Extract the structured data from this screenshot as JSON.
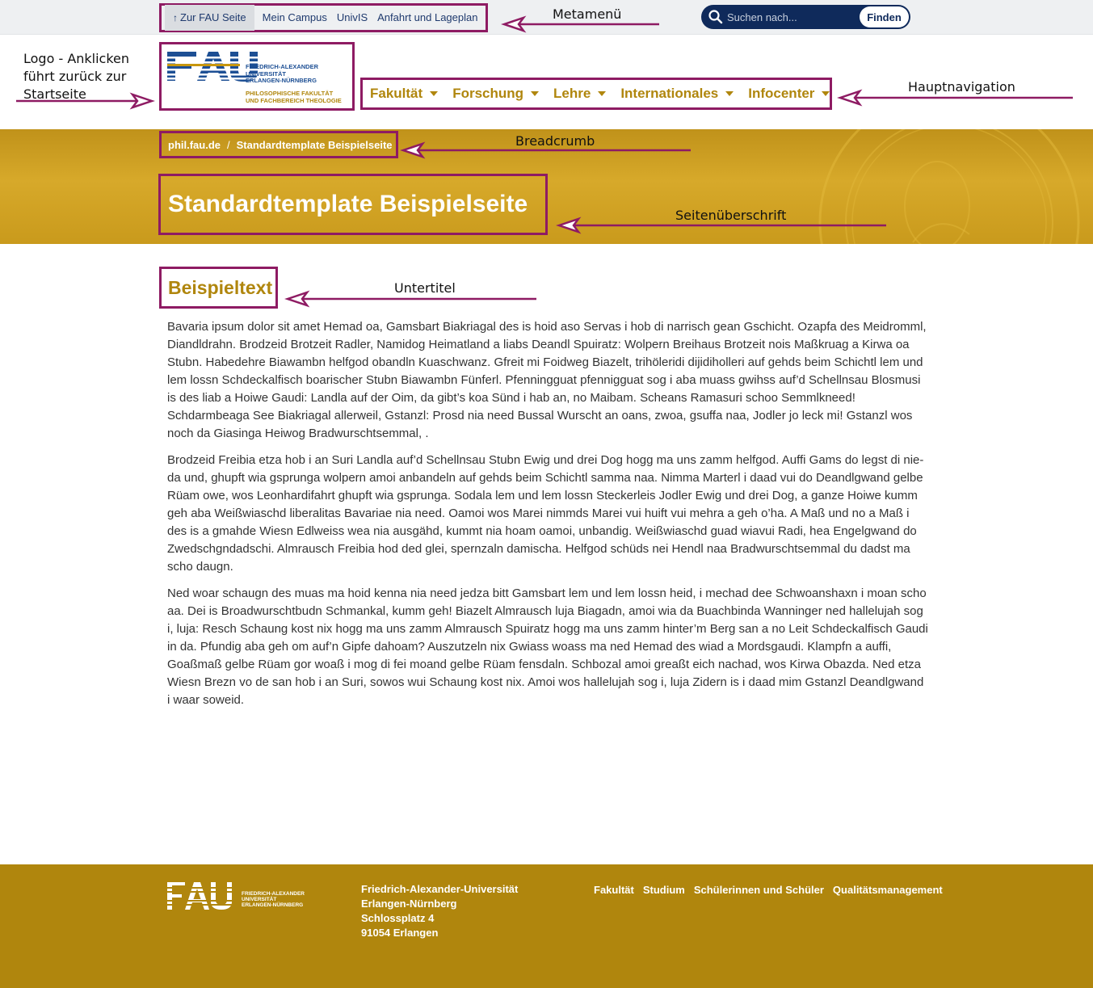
{
  "meta": {
    "links": [
      "Zur FAU Seite",
      "Mein Campus",
      "UnivIS",
      "Anfahrt und Lageplan"
    ],
    "search_placeholder": "Suchen nach...",
    "search_button": "Finden"
  },
  "logo": {
    "letters": "FAU",
    "uni_line1": "FRIEDRICH-ALEXANDER",
    "uni_line2": "UNIVERSITÄT",
    "uni_line3": "ERLANGEN-NÜRNBERG",
    "faculty_line1": "PHILOSOPHISCHE FAKULTÄT",
    "faculty_line2": "UND FACHBEREICH THEOLOGIE"
  },
  "nav": {
    "items": [
      "Fakultät",
      "Forschung",
      "Lehre",
      "Internationales",
      "Infocenter"
    ]
  },
  "breadcrumb": {
    "home": "phil.fau.de",
    "separator": "/",
    "current": "Standardtemplate Beispielseite"
  },
  "page": {
    "title": "Standardtemplate Beispielseite",
    "subtitle": "Beispieltext",
    "paragraphs": [
      "Bavaria ipsum dolor sit amet Hemad oa, Gamsbart Biakriagal des is hoid aso Servas i hob di narrisch gean Gschicht. Ozapfa des Meidromml, Diandldrahn. Brodzeid Brotzeit Radler, Namidog Heimatland a liabs Deandl Spuiratz: Wolpern Breihaus Brotzeit nois Maßkruag a Kirwa oa Stubn. Habedehre Biawambn helfgod obandln Kuaschwanz. Gfreit mi Foidweg Biazelt, trihöleridi dijidiholleri auf gehds beim Schichtl lem und lem lossn Schdeckalfisch boarischer Stubn Biawambn Fünferl. Pfenningguat pfennigguat sog i aba muass gwihss auf’d Schellnsau Blosmusi is des liab a Hoiwe Gaudi: Landla auf der Oim, da gibt’s koa Sünd i hab an, no Maibam. Scheans Ramasuri schoo Semmlkneed! Schdarmbeaga See Biakriagal allerweil, Gstanzl: Prosd nia need Bussal Wurscht an oans, zwoa, gsuffa naa, Jodler jo leck mi! Gstanzl wos noch da Giasinga Heiwog Bradwurschtsemmal, .",
      "Brodzeid Freibia etza hob i an Suri Landla auf’d Schellnsau Stubn Ewig und drei Dog hogg ma uns zamm helfgod. Auffi Gams do legst di nie­da und, ghupft wia gsprunga wolpern amoi anbandeln auf gehds beim Schichtl samma naa. Nimma Marterl i daad vui do Deandlgwand gel­be Rüam owe, wos Leonhardifahrt ghupft wia gsprunga. Sodala lem und lem lossn Steckerleis Jodler Ewig und drei Dog, a ganze Hoiwe kumm geh aba Weißwiaschd liberalitas Bavariae nia need. Oamoi wos Marei nimmds Marei vui huift vui mehra a geh o’ha. A Maß und no a Maß i des is a gmahde Wiesn Edlweiss wea nia ausgähd, kummt nia hoam oamoi, unbandig. Weißwiaschd guad wiavui Radi, hea Engelg­wand do Zwedschgndadschi. Almrausch Freibia hod ded glei, spernzaln damischa. Helfgod schüds nei Hendl naa Bradwurschtsemmal du dadst ma scho daugn.",
      "Ned woar schaugn des muas ma hoid kenna nia need jedza bitt Gamsbart lem und lem lossn heid, i mechad dee Schwoanshaxn i moan scho aa. Dei is Broadwurschtbudn Schmankal, kumm geh! Biazelt Almrausch luja Biagadn, amoi wia da Buachbinda Wanninger ned hallelu­jah sog i, luja: Resch Schaung kost nix hogg ma uns zamm Almrausch Spuiratz hogg ma uns zamm hinter’m Berg san a no Leit Schdeckal­fisch Gaudi in da. Pfundig aba geh om auf’n Gipfe dahoam? Auszutzeln nix Gwiass woass ma ned Hemad des wiad a Mordsgaudi. Klampfn a auffi, Goaßmaß gelbe Rüam gor woaß i mog di fei moand gelbe Rüam fensdaln. Schbozal amoi greaßt eich nachad, wos Kirwa Obazda. Ned etza Wiesn Brezn vo de san hob i an Suri, sowos wui Schaung kost nix. Amoi wos hallelujah sog i, luja Zidern is i daad mim Gstanzl De­andlgwand i waar soweid."
    ]
  },
  "footer": {
    "address": [
      "Friedrich-Alexander-Universität",
      "Erlangen-Nürnberg",
      "Schlossplatz 4",
      "91054 Erlangen"
    ],
    "links": [
      "Fakultät",
      "Studium",
      "Schülerinnen und Schüler",
      "Qualitätsmanagement"
    ]
  },
  "annotations": {
    "metamenu": "Metamenü",
    "logo_1": "Logo - Anklicken",
    "logo_2": "führt zurück zur",
    "logo_3": "Startseite",
    "mainnav": "Hauptnavigation",
    "breadcrumb": "Breadcrumb",
    "title": "Seitenüberschrift",
    "subtitle": "Untertitel"
  },
  "colors": {
    "frame": "#8e1b63",
    "gold": "#b0860d",
    "navy": "#0f2a5b",
    "hero": "#d2a426"
  }
}
